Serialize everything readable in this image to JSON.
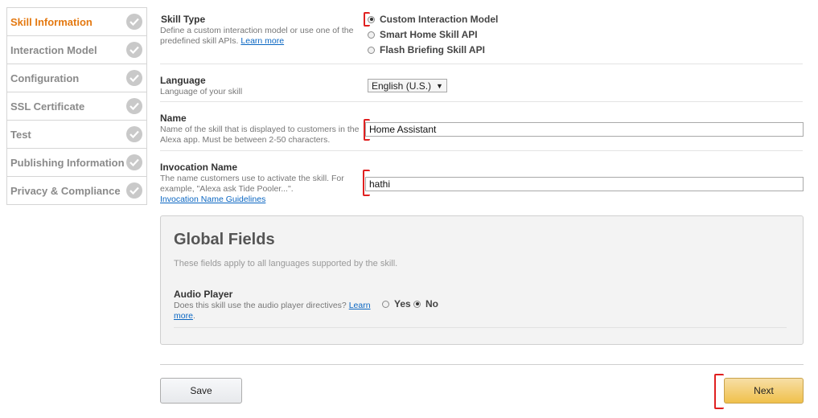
{
  "sidebar": {
    "items": [
      {
        "label": "Skill Information",
        "active": true
      },
      {
        "label": "Interaction Model",
        "active": false
      },
      {
        "label": "Configuration",
        "active": false
      },
      {
        "label": "SSL Certificate",
        "active": false
      },
      {
        "label": "Test",
        "active": false
      },
      {
        "label": "Publishing Information",
        "active": false
      },
      {
        "label": "Privacy & Compliance",
        "active": false
      }
    ],
    "check_icon": "checkmark-icon"
  },
  "skill_type": {
    "title": "Skill Type",
    "desc_line1": "Define a custom interaction model or use one of the",
    "desc_line2": "predefined skill APIs.",
    "learn_more": "Learn more",
    "options": [
      {
        "label": "Custom Interaction Model",
        "selected": true
      },
      {
        "label": "Smart Home Skill API",
        "selected": false
      },
      {
        "label": "Flash Briefing Skill API",
        "selected": false
      }
    ]
  },
  "language": {
    "title": "Language",
    "desc": "Language of your skill",
    "selected": "English (U.S.)"
  },
  "name": {
    "title": "Name",
    "desc_line1": "Name of the skill that is displayed to customers in the",
    "desc_line2": "Alexa app. Must be between 2-50 characters.",
    "value": "Home Assistant"
  },
  "invocation": {
    "title": "Invocation Name",
    "desc_line1": "The name customers use to activate the skill. For",
    "desc_line2": "example, \"Alexa ask Tide Pooler...\".",
    "guidelines_link": "Invocation Name Guidelines",
    "value": "hathi"
  },
  "global_fields": {
    "title": "Global Fields",
    "subtitle": "These fields apply to all languages supported by the skill.",
    "audio_player": {
      "title": "Audio Player",
      "desc": "Does this skill use the audio player directives?",
      "learn": "Learn",
      "more": "more",
      "yes_label": "Yes",
      "no_label": "No",
      "selected": "No"
    }
  },
  "actions": {
    "save_label": "Save",
    "next_label": "Next"
  },
  "colors": {
    "active_nav": "#e47911",
    "annotation": "#e02020",
    "next_button": "#f0c14b",
    "link": "#0a66c2"
  }
}
